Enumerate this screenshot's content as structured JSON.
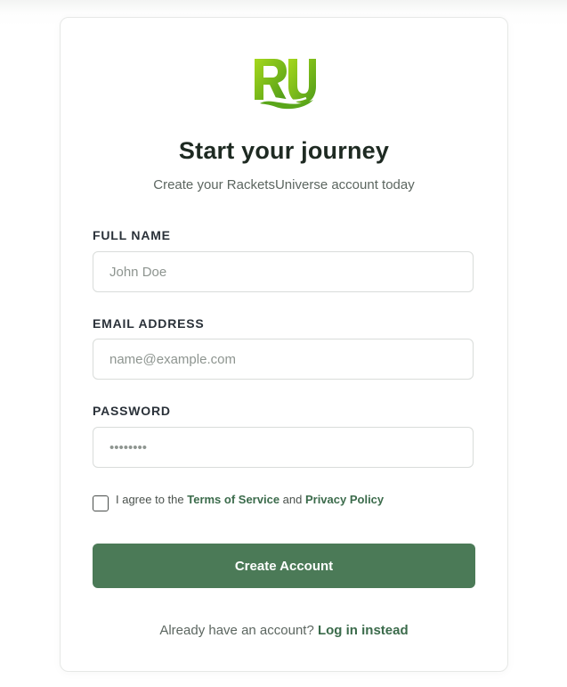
{
  "brand": {
    "logo_text": "RU",
    "logo_color_light": "#9bd21a",
    "logo_color_dark": "#5aa61a"
  },
  "header": {
    "title": "Start your journey",
    "subtitle": "Create your RacketsUniverse account today"
  },
  "form": {
    "full_name": {
      "label": "FULL NAME",
      "placeholder": "John Doe",
      "value": ""
    },
    "email": {
      "label": "EMAIL ADDRESS",
      "placeholder": "name@example.com",
      "value": ""
    },
    "password": {
      "label": "PASSWORD",
      "placeholder": "••••••••",
      "value": ""
    },
    "agreement": {
      "checked": false,
      "prefix": "I agree to the ",
      "terms_link": "Terms of Service",
      "conjunction": " and ",
      "privacy_link": "Privacy Policy"
    },
    "submit_label": "Create Account"
  },
  "footer": {
    "prompt": "Already have an account? ",
    "login_link": "Log in instead"
  },
  "colors": {
    "primary": "#4b7a57",
    "link": "#3b6b4b"
  }
}
